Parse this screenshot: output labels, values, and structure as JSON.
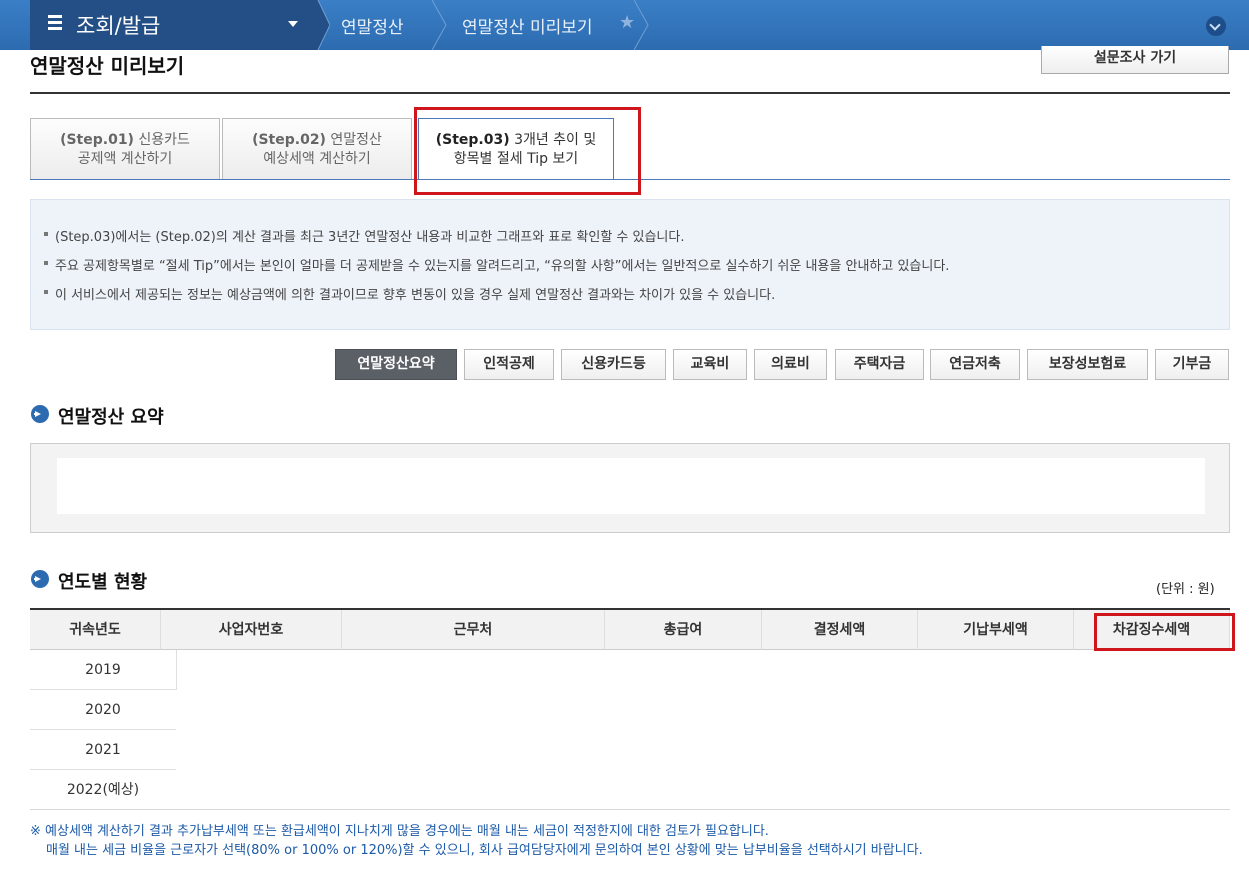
{
  "nav": {
    "menu_title": "조회/발급",
    "crumb1": "연말정산",
    "crumb2": "연말정산 미리보기"
  },
  "page": {
    "title": "연말정산 미리보기",
    "survey_button": "설문조사 가기"
  },
  "tabs": [
    {
      "step": "(Step.01)",
      "line1": "신용카드",
      "line2": "공제액 계산하기"
    },
    {
      "step": "(Step.02)",
      "line1": "연말정산",
      "line2": "예상세액 계산하기"
    },
    {
      "step": "(Step.03)",
      "line1": "3개년 추이 및",
      "line2": "항목별 절세 Tip 보기"
    }
  ],
  "info": [
    "(Step.03)에서는 (Step.02)의 계산 결과를 최근 3년간 연말정산 내용과 비교한 그래프와 표로 확인할 수 있습니다.",
    "주요 공제항목별로 “절세 Tip”에서는 본인이 얼마를 더 공제받을 수 있는지를 알려드리고, “유의할 사항”에서는 일반적으로 실수하기 쉬운 내용을 안내하고 있습니다.",
    "이 서비스에서 제공되는 정보는 예상금액에 의한 결과이므로 향후 변동이 있을 경우 실제 연말정산 결과와는 차이가 있을 수 있습니다."
  ],
  "categories": [
    "연말정산요약",
    "인적공제",
    "신용카드등",
    "교육비",
    "의료비",
    "주택자금",
    "연금저축",
    "보장성보험료",
    "기부금"
  ],
  "sections": {
    "summary": "연말정산 요약",
    "yearly": "연도별 현황"
  },
  "unit": "(단위 : 원)",
  "table": {
    "headers": [
      "귀속년도",
      "사업자번호",
      "근무처",
      "총급여",
      "결정세액",
      "기납부세액",
      "차감징수세액"
    ],
    "years": [
      "2019",
      "2020",
      "2021",
      "2022(예상)"
    ]
  },
  "notes": [
    "※ 예상세액 계산하기 결과 추가납부세액 또는 환급세액이 지나치게 많을 경우에는 매월 내는 세금이 적정한지에 대한 검토가 필요합니다.",
    "매월 내는 세금 비율을 근로자가 선택(80% or 100% or 120%)할 수 있으니, 회사 급여담당자에게 문의하여 본인 상황에 맞는 납부비율을 선택하시기 바랍니다."
  ]
}
